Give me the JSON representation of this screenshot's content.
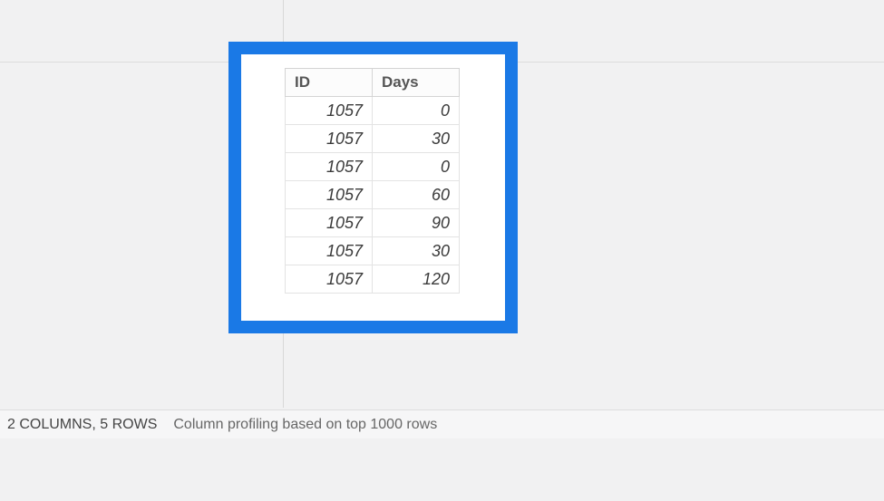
{
  "table": {
    "columns": [
      "ID",
      "Days"
    ],
    "rows": [
      {
        "id": 1057,
        "days": 0
      },
      {
        "id": 1057,
        "days": 30
      },
      {
        "id": 1057,
        "days": 0
      },
      {
        "id": 1057,
        "days": 60
      },
      {
        "id": 1057,
        "days": 90
      },
      {
        "id": 1057,
        "days": 30
      },
      {
        "id": 1057,
        "days": 120
      }
    ]
  },
  "status": {
    "counts": "2 COLUMNS, 5 ROWS",
    "profiling": "Column profiling based on top 1000 rows"
  }
}
